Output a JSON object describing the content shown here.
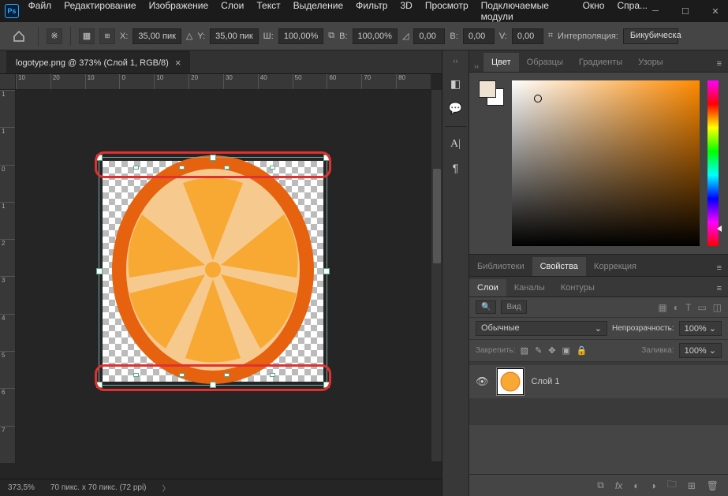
{
  "app": {
    "icon_label": "Ps"
  },
  "menu": [
    "Файл",
    "Редактирование",
    "Изображение",
    "Слои",
    "Текст",
    "Выделение",
    "Фильтр",
    "3D",
    "Просмотр",
    "Подключаемые модули",
    "Окно",
    "Спра..."
  ],
  "options": {
    "x_label": "X:",
    "x_value": "35,00 пик",
    "y_label": "Y:",
    "y_value": "35,00 пик",
    "w_label": "Ш:",
    "w_value": "100,00%",
    "h_label": "В:",
    "h_value": "100,00%",
    "angle_value": "0,00",
    "skew_h_label": "В:",
    "skew_h_value": "0,00",
    "skew_v_label": "V:",
    "skew_v_value": "0,00",
    "interp_label": "Интерполяция:",
    "interp_value": "Бикубическа"
  },
  "document": {
    "tab_title": "logotype.png @ 373% (Слой 1, RGB/8)"
  },
  "rulers": {
    "h": [
      "10",
      "20",
      "10",
      "0",
      "10",
      "20",
      "30",
      "40",
      "50",
      "60",
      "70",
      "80"
    ],
    "v": [
      "1",
      "1",
      "0",
      "1",
      "2",
      "3",
      "4",
      "5",
      "6",
      "7"
    ]
  },
  "status": {
    "zoom": "373,5%",
    "docinfo": "70 пикс. x 70 пикс. (72 ppi)"
  },
  "color_panel": {
    "tabs": [
      "Цвет",
      "Образцы",
      "Градиенты",
      "Узоры"
    ],
    "active": 0
  },
  "props_panel": {
    "tabs": [
      "Библиотеки",
      "Свойства",
      "Коррекция"
    ],
    "active": 1
  },
  "layers_panel": {
    "tabs": [
      "Слои",
      "Каналы",
      "Контуры"
    ],
    "active": 0,
    "search_placeholder": "Вид",
    "blend_mode": "Обычные",
    "opacity_label": "Непрозрачность:",
    "opacity_value": "100%",
    "lock_label": "Закрепить:",
    "fill_label": "Заливка:",
    "fill_value": "100%",
    "layer_name": "Слой 1"
  }
}
